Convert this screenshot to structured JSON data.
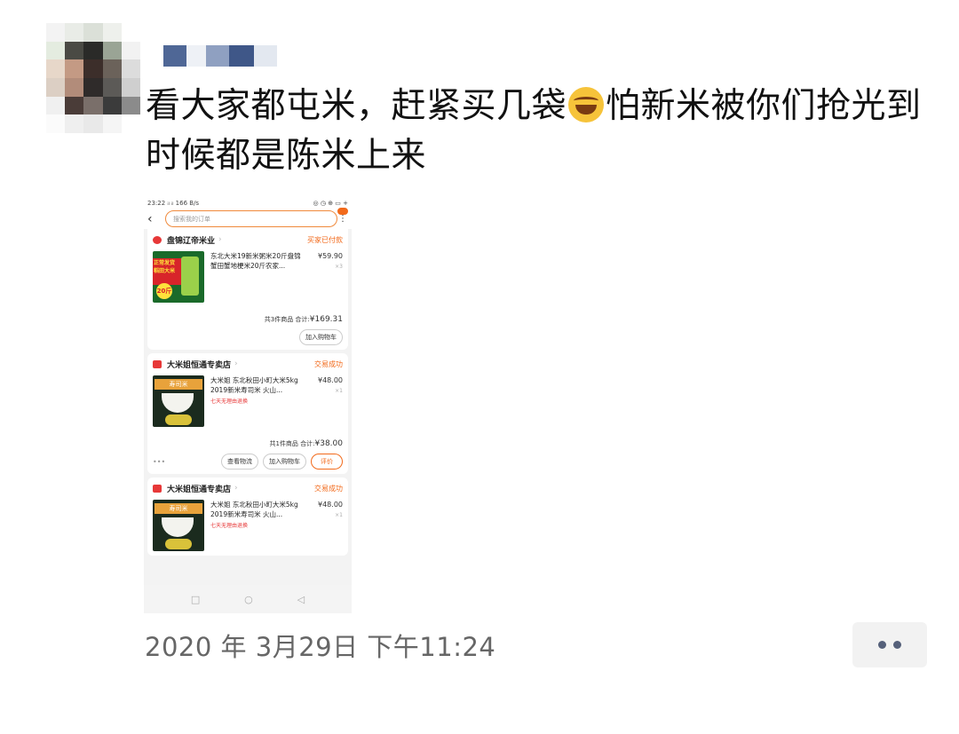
{
  "post": {
    "author_blurred": true,
    "text_part1": "看大家都屯米，赶紧买几袋",
    "emoji_icon": "tears-of-joy-emoji",
    "text_part2": "怕新米被你们抢光到时候都是陈米上来",
    "timestamp": "2020 年 3月29日 下午11:24"
  },
  "screenshot": {
    "status_bar": {
      "left": "23:22 ᵢₗ ᵢₗ 166 B/s",
      "right": "◎ ◷ ⊕ ▭ +"
    },
    "search_placeholder": "搜索我的订单",
    "orders": [
      {
        "shop": "盘锦辽帝米业",
        "status": "买家已付款",
        "thumb_tag": "正常发货 稻田大米",
        "thumb_num": "20斤",
        "item_title": "东北大米19新米粥米20斤盘锦蟹田蟹地梗米20斤农家...",
        "price": "¥59.90",
        "qty": "×3",
        "summary": "共3件商品 合计:",
        "total": "¥169.31",
        "buttons": [
          "加入购物车"
        ]
      },
      {
        "shop": "大米姐恒通专卖店",
        "status": "交易成功",
        "thumb_label": "寿司米",
        "item_title": "大米姐 东北秋田小町大米5kg 2019新米寿司米 火山...",
        "promo": "七天无理由退换",
        "price": "¥48.00",
        "qty": "×1",
        "summary": "共1件商品 合计:",
        "total": "¥38.00",
        "more": "•••",
        "buttons": [
          "查看物流",
          "加入购物车",
          "评价"
        ]
      },
      {
        "shop": "大米姐恒通专卖店",
        "status": "交易成功",
        "thumb_label": "寿司米",
        "item_title": "大米姐 东北秋田小町大米5kg 2019新米寿司米 火山...",
        "promo": "七天无理由退换",
        "price": "¥48.00",
        "qty": "×1"
      }
    ],
    "nav": [
      "□",
      "○",
      "◁"
    ]
  },
  "colors": {
    "accent": "#f26a1b",
    "shop_icon": "#e73838",
    "more_dots": "#55607a"
  }
}
